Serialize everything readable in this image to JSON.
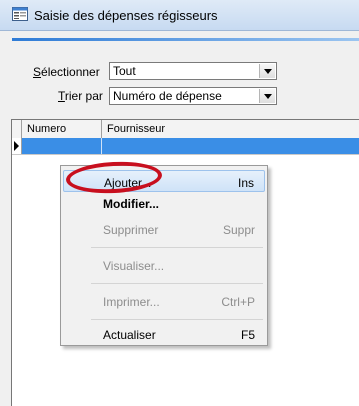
{
  "window": {
    "title": "Saisie des dépenses régisseurs",
    "icon": "form-window-icon"
  },
  "filters": {
    "select_label_prefix": "S",
    "select_label_rest": "électionner",
    "select_value": "Tout",
    "sort_label_prefix": "T",
    "sort_label_rest": "rier par",
    "sort_value": "Numéro de dépense"
  },
  "grid": {
    "columns": [
      "Numero",
      "Fournisseur"
    ],
    "row_indicator": "▶"
  },
  "context_menu": {
    "items": [
      {
        "label": "Ajouter...",
        "shortcut": "Ins",
        "state": "highlighted"
      },
      {
        "label": "Modifier...",
        "shortcut": "",
        "state": "enabled"
      },
      {
        "label": "Supprimer",
        "shortcut": "Suppr",
        "state": "disabled"
      },
      {
        "label": "Visualiser...",
        "shortcut": "",
        "state": "disabled"
      },
      {
        "label": "Imprimer...",
        "shortcut": "Ctrl+P",
        "state": "disabled"
      },
      {
        "label": "Actualiser",
        "shortcut": "F5",
        "state": "enabled"
      }
    ]
  },
  "colors": {
    "selection": "#3a8ee6",
    "annotation": "#c80f1e",
    "menu_highlight": "#cfe3f8"
  }
}
